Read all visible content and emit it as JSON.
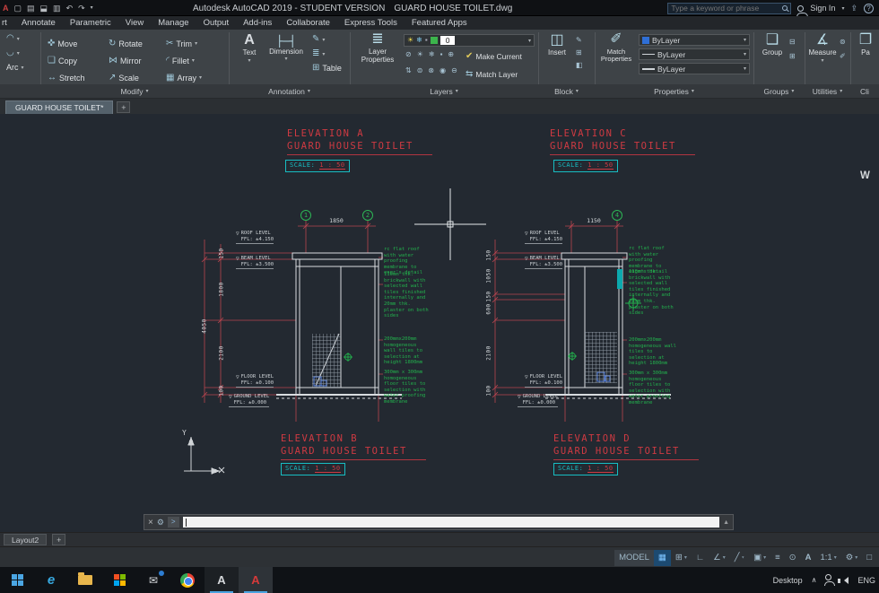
{
  "title_bar": {
    "app_title": "Autodesk AutoCAD 2019 - STUDENT VERSION",
    "doc_title": "GUARD HOUSE TOILET.dwg",
    "search_placeholder": "Type a keyword or phrase",
    "sign_in_label": "Sign In",
    "help_label": "?"
  },
  "ribbon_tabs": [
    "rt",
    "Annotate",
    "Parametric",
    "View",
    "Manage",
    "Output",
    "Add-ins",
    "Collaborate",
    "Express Tools",
    "Featured Apps"
  ],
  "ribbon": {
    "draw_panel": {
      "arc_label": "Arc"
    },
    "modify_panel": {
      "label": "Modify",
      "move": "Move",
      "rotate": "Rotate",
      "trim": "Trim",
      "copy": "Copy",
      "mirror": "Mirror",
      "fillet": "Fillet",
      "stretch": "Stretch",
      "scale": "Scale",
      "array": "Array"
    },
    "annotation_panel": {
      "label": "Annotation",
      "text": "Text",
      "dimension": "Dimension",
      "table": "Table"
    },
    "layers_panel": {
      "label": "Layers",
      "layer_properties": "Layer Properties",
      "current_layer": "0",
      "make_current": "Make Current",
      "match_layer": "Match Layer"
    },
    "block_panel": {
      "label": "Block",
      "insert": "Insert"
    },
    "properties_panel": {
      "label": "Properties",
      "match_properties": "Match Properties",
      "color_value": "ByLayer",
      "linetype_value": "ByLayer",
      "lineweight_value": "ByLayer"
    },
    "groups_panel": {
      "label": "Groups",
      "group": "Group"
    },
    "utilities_panel": {
      "label": "Utilities",
      "measure": "Measure"
    },
    "clipboard_panel": {
      "label": "Cli",
      "paste": "Pa"
    }
  },
  "file_tab": {
    "name": "GUARD HOUSE TOILET*",
    "add": "+"
  },
  "drawing": {
    "scale_label": "SCALE:",
    "scale_value": "1 : 50",
    "elev_a": {
      "title": "ELEVATION A\nGUARD HOUSE TOILET",
      "bubble_1": "1",
      "bubble_2": "2",
      "top_dim": "1850",
      "dim_1": "150",
      "dim_2": "1800",
      "dim_3": "2100",
      "dim_4": "100",
      "dim_total": "4050"
    },
    "elev_c": {
      "title": "ELEVATION C\nGUARD HOUSE TOILET",
      "bubble_4": "4",
      "top_dim": "1150",
      "dim_1": "150",
      "dim_2": "1050",
      "dim_3": "150",
      "dim_4": "600",
      "dim_5": "2100",
      "dim_6": "100"
    },
    "elev_b": {
      "title": "ELEVATION B\nGUARD HOUSE TOILET"
    },
    "elev_d": {
      "title": "ELEVATION D\nGUARD HOUSE TOILET"
    },
    "levels": {
      "roof": "ROOF LEVEL\nFFL: ±4.150",
      "beam": "BEAM LEVEL\nFFL: ±3.500",
      "floor": "FLOOR LEVEL\nFFL: ±0.100",
      "ground": "GROUND LEVEL\nFFL: ±0.000"
    },
    "notes": {
      "roof": "rc flat roof with water proofing membrane to engr's detail",
      "wall": "110mm thk. brickwall with selected wall tiles finished internally and 20mm thk. plaster on both sides",
      "wall_tiles": "200mmx200mm homogeneous wall tiles to selection at height 1800mm",
      "floor_tiles": "300mm x 300mm homogeneous floor tiles to selection with water proofing membrane"
    },
    "ucs_y": "Y",
    "viewcube_w": "W"
  },
  "layout_bar": {
    "layout2": "Layout2",
    "add": "+"
  },
  "status_bar": {
    "model": "MODEL",
    "annotation_scale": "1:1"
  },
  "taskbar": {
    "desktop_label": "Desktop",
    "language": "ENG"
  }
}
